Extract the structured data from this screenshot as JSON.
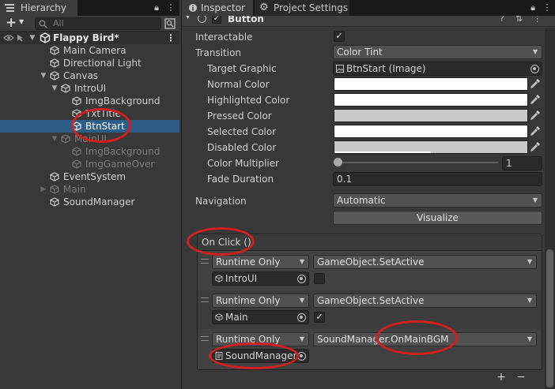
{
  "hierarchy": {
    "tab_label": "Hierarchy",
    "search_placeholder": "All",
    "add_label": "+",
    "scene": "Flappy Bird*",
    "items": [
      {
        "label": "Main Camera"
      },
      {
        "label": "Directional Light"
      },
      {
        "label": "Canvas"
      },
      {
        "label": "IntroUI"
      },
      {
        "label": "ImgBackground"
      },
      {
        "label": "TxtTitle"
      },
      {
        "label": "BtnStart"
      },
      {
        "label": "MainUI"
      },
      {
        "label": "ImgBackground"
      },
      {
        "label": "ImgGameOver"
      },
      {
        "label": "EventSystem"
      },
      {
        "label": "Main"
      },
      {
        "label": "SoundManager"
      }
    ]
  },
  "inspector": {
    "tab_inspector": "Inspector",
    "tab_project_settings": "Project Settings",
    "component_title": "Button",
    "interactable_label": "Interactable",
    "transition_label": "Transition",
    "transition_value": "Color Tint",
    "target_graphic_label": "Target Graphic",
    "target_graphic_value": "BtnStart (Image)",
    "normal_color_label": "Normal Color",
    "highlighted_color_label": "Highlighted Color",
    "pressed_color_label": "Pressed Color",
    "selected_color_label": "Selected Color",
    "disabled_color_label": "Disabled Color",
    "color_multiplier_label": "Color Multiplier",
    "color_multiplier_value": "1",
    "fade_duration_label": "Fade Duration",
    "fade_duration_value": "0.1",
    "navigation_label": "Navigation",
    "navigation_value": "Automatic",
    "visualize_label": "Visualize",
    "onclick_label": "On Click ()",
    "events": [
      {
        "mode": "Runtime Only",
        "function": "GameObject.SetActive",
        "target": "IntroUI",
        "checked": false
      },
      {
        "mode": "Runtime Only",
        "function": "GameObject.SetActive",
        "target": "Main",
        "checked": true
      },
      {
        "mode": "Runtime Only",
        "function": "SoundManager.OnMainBGM",
        "target": "SoundManager"
      }
    ],
    "add_label": "+",
    "remove_label": "−"
  },
  "colors": {
    "selection": "#2c5d87",
    "annotation": "#d0201f",
    "panel_bg": "#383838"
  },
  "icons": {
    "hierarchy_tab": "list-icon",
    "inspector_tab": "info-icon",
    "project_settings_tab": "gear-icon",
    "game_object": "cube-icon",
    "scene": "unity-logo-icon",
    "eyedropper": "eyedropper-icon",
    "object_picker": "target-icon"
  }
}
